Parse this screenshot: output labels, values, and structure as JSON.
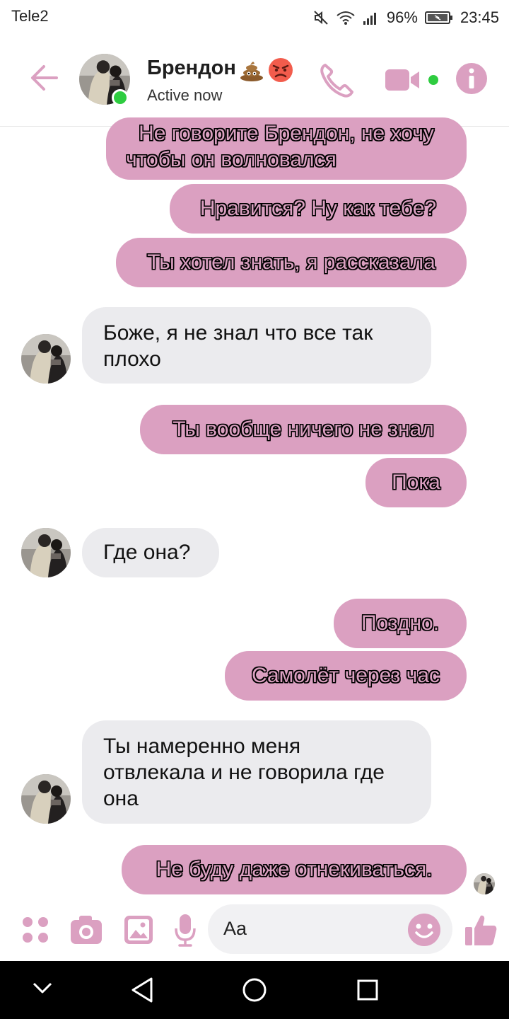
{
  "status": {
    "carrier": "Tele2",
    "battery": "96%",
    "time": "23:45"
  },
  "header": {
    "name": "Брендон",
    "name_emoji": [
      "poop",
      "angry-face"
    ],
    "presence": "Active now"
  },
  "messages": [
    {
      "side": "out",
      "text_line1": "Не говорите Брендон, не хочу",
      "text_line2": "чтобы он волновался"
    },
    {
      "side": "out",
      "text": "Нравится? Ну как тебе?"
    },
    {
      "side": "out",
      "text": "Ты хотел знать, я рассказала"
    },
    {
      "side": "in",
      "text_line1": "Боже, я не знал что все так",
      "text_line2": "плохо"
    },
    {
      "side": "out",
      "text": "Ты вообще ничего не знал"
    },
    {
      "side": "out",
      "text": "Пока"
    },
    {
      "side": "in",
      "text": "Где она?"
    },
    {
      "side": "out",
      "text": "Поздно."
    },
    {
      "side": "out",
      "text": "Самолёт через час"
    },
    {
      "side": "in",
      "text_line1": "Ты намеренно меня",
      "text_line2": "отвлекала и не говорила где",
      "text_line3": "она"
    },
    {
      "side": "out",
      "text": "Не буду даже отнекиваться."
    }
  ],
  "composer": {
    "placeholder": "Aa"
  },
  "colors": {
    "accent": "#dba0c1",
    "incoming_bubble": "#ebebee",
    "online": "#2ecc40"
  }
}
